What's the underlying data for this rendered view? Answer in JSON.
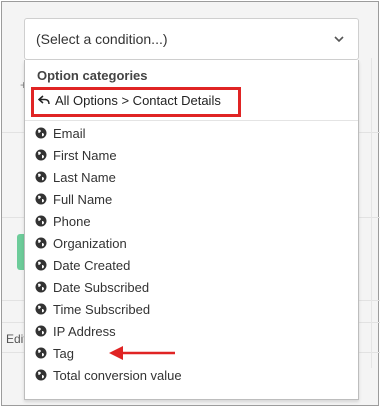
{
  "select": {
    "value": "(Select a condition...)",
    "chevron_icon": "chevron-down-icon"
  },
  "dropdown": {
    "header": "Option categories",
    "breadcrumb": "All Options > Contact Details",
    "breadcrumb_icon": "back-arrow-icon",
    "item_icon": "globe-icon",
    "items": [
      "Email",
      "First Name",
      "Last Name",
      "Full Name",
      "Phone",
      "Organization",
      "Date Created",
      "Date Subscribed",
      "Time Subscribed",
      "IP Address",
      "Tag",
      "Total conversion value"
    ]
  },
  "background": {
    "plus_glyph": "+",
    "edit_label": "Edit"
  },
  "colors": {
    "highlight": "#e02424",
    "accent_green": "#6dcc9a"
  }
}
